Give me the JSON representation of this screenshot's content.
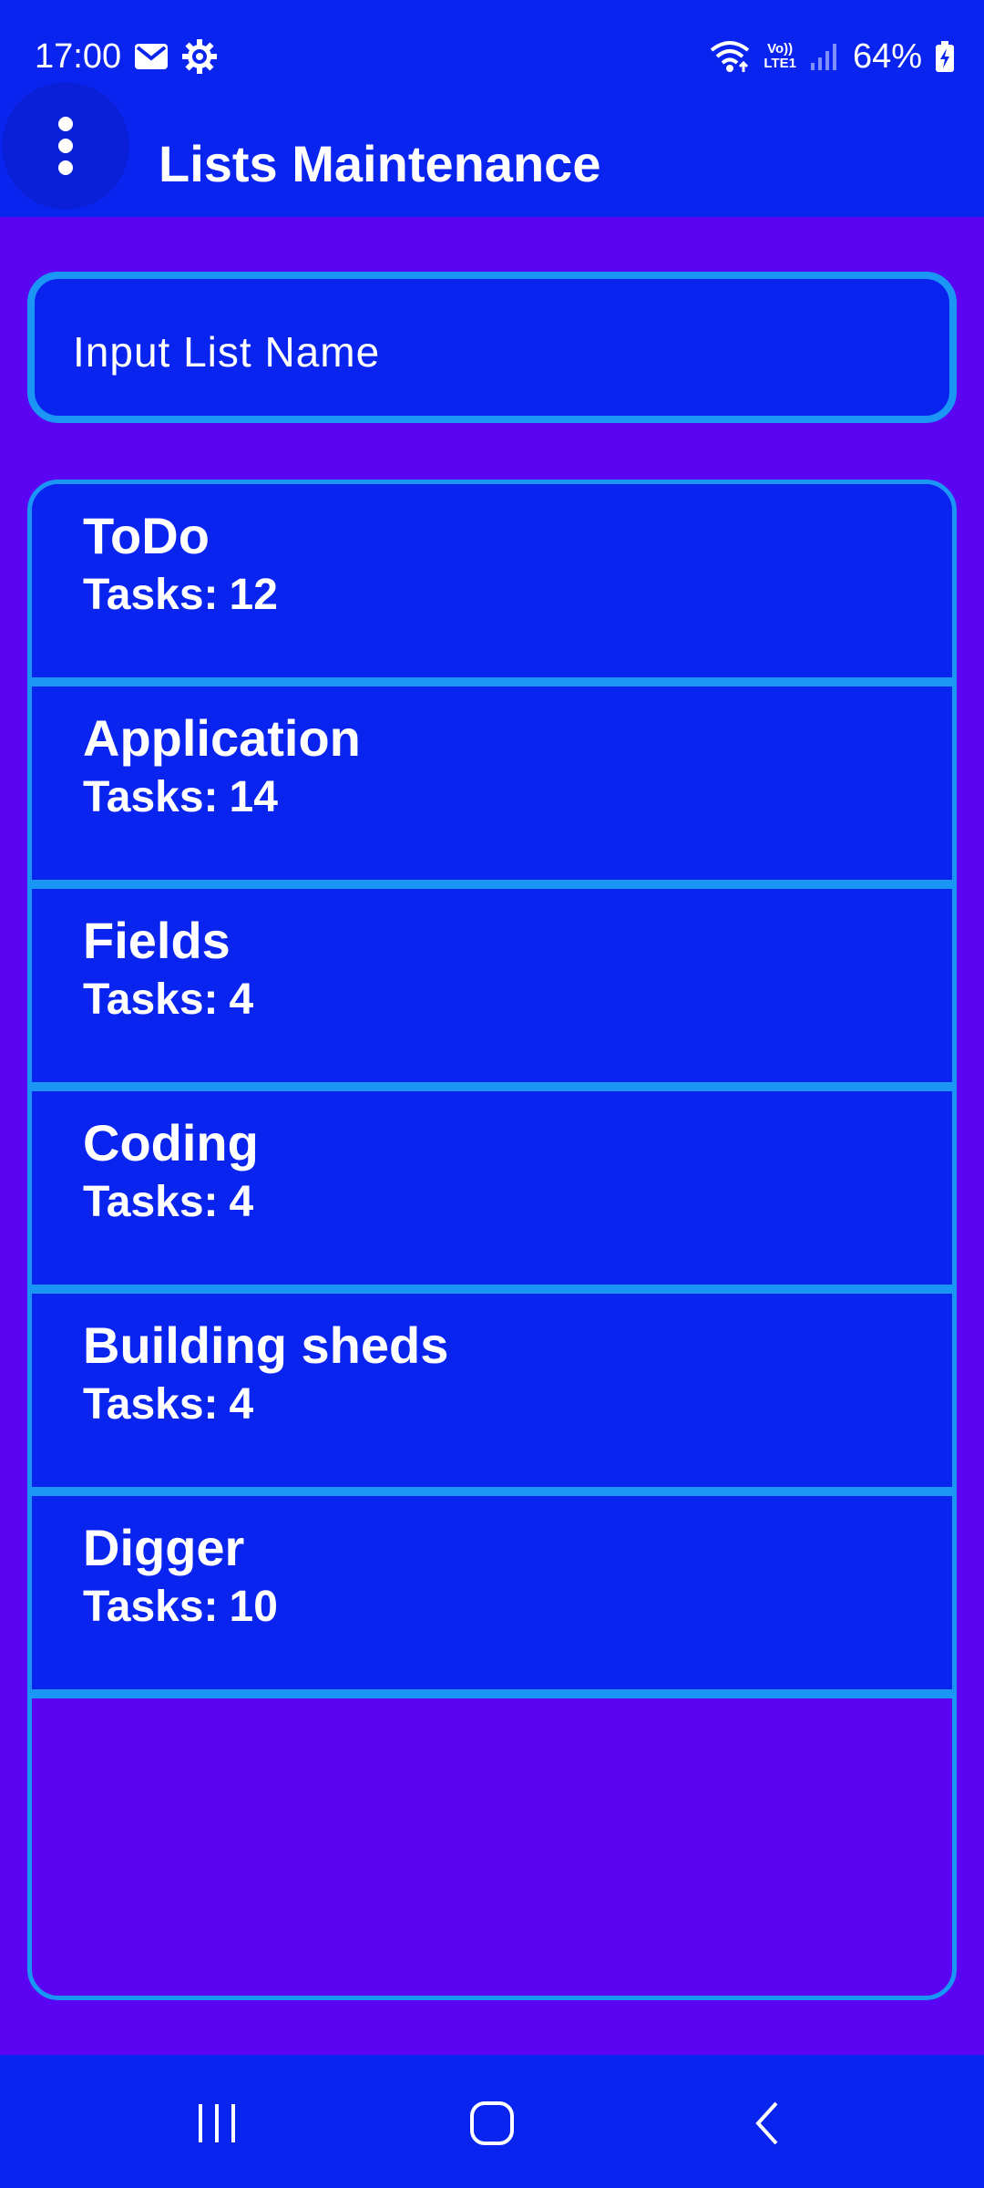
{
  "status_bar": {
    "time": "17:00",
    "lte_label_top": "Vo))",
    "lte_label_bottom": "LTE1",
    "battery": "64%",
    "icons": [
      "mail-icon",
      "settings-gear-icon",
      "wifi-icon",
      "signal-icon",
      "battery-charging-icon"
    ]
  },
  "app_bar": {
    "title": "Lists Maintenance",
    "menu_icon": "more-vert-icon"
  },
  "input": {
    "placeholder": "Input List Name",
    "value": ""
  },
  "lists": [
    {
      "name": "ToDo",
      "count_label": "Tasks:",
      "count": "12"
    },
    {
      "name": "Application",
      "count_label": "Tasks:",
      "count": "14"
    },
    {
      "name": "Fields",
      "count_label": "Tasks:",
      "count": "4"
    },
    {
      "name": "Coding",
      "count_label": "Tasks:",
      "count": "4"
    },
    {
      "name": "Building sheds",
      "count_label": "Tasks:",
      "count": "4"
    },
    {
      "name": "Digger",
      "count_label": "Tasks:",
      "count": "10"
    }
  ],
  "nav_bar": {
    "icons": [
      "recents-icon",
      "home-icon",
      "back-icon"
    ]
  },
  "colors": {
    "background": "#5a04f2",
    "bars": "#0a24f0",
    "accent_border": "#1a97f5",
    "text": "#ffffff"
  }
}
